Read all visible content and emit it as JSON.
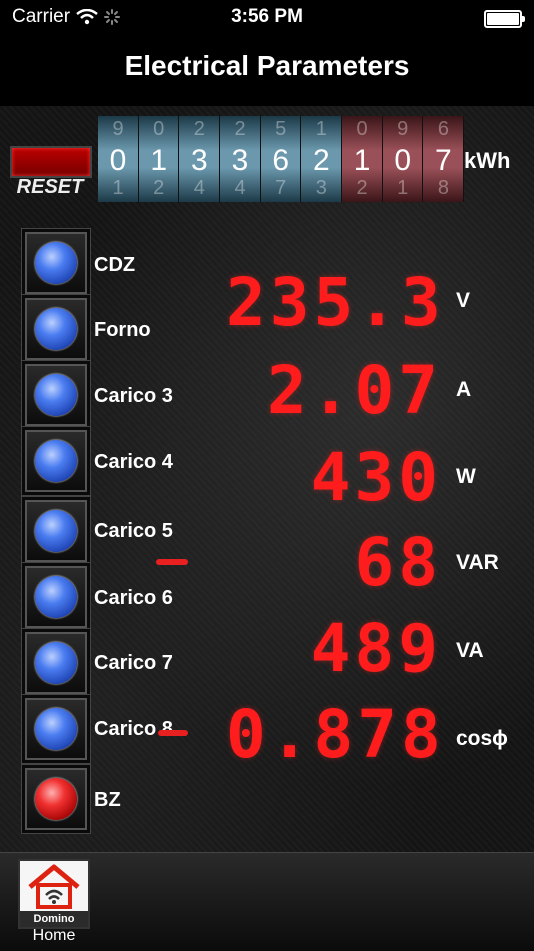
{
  "status_bar": {
    "carrier": "Carrier",
    "time": "3:56 PM"
  },
  "nav": {
    "title": "Electrical Parameters"
  },
  "reset": {
    "label": "RESET"
  },
  "energy": {
    "unit": "kWh",
    "digits": [
      {
        "prev": "9",
        "cur": "0",
        "next": "1",
        "style": "blue"
      },
      {
        "prev": "0",
        "cur": "1",
        "next": "2",
        "style": "blue"
      },
      {
        "prev": "2",
        "cur": "3",
        "next": "4",
        "style": "blue"
      },
      {
        "prev": "2",
        "cur": "3",
        "next": "4",
        "style": "blue"
      },
      {
        "prev": "5",
        "cur": "6",
        "next": "7",
        "style": "blue"
      },
      {
        "prev": "1",
        "cur": "2",
        "next": "3",
        "style": "blue"
      },
      {
        "prev": "0",
        "cur": "1",
        "next": "2",
        "style": "red"
      },
      {
        "prev": "9",
        "cur": "0",
        "next": "1",
        "style": "red"
      },
      {
        "prev": "6",
        "cur": "7",
        "next": "8",
        "style": "red"
      }
    ]
  },
  "loads": [
    {
      "label": "CDZ",
      "led": "blue"
    },
    {
      "label": "Forno",
      "led": "blue"
    },
    {
      "label": "Carico 3",
      "led": "blue"
    },
    {
      "label": "Carico 4",
      "led": "blue"
    },
    {
      "label": "Carico 5",
      "led": "blue"
    },
    {
      "label": "Carico 6",
      "led": "blue"
    },
    {
      "label": "Carico 7",
      "led": "blue"
    },
    {
      "label": "Carico 8",
      "led": "blue"
    },
    {
      "label": "BZ",
      "led": "red"
    }
  ],
  "readings": [
    {
      "value": "235.3",
      "unit": "V"
    },
    {
      "value": "2.07",
      "unit": "A"
    },
    {
      "value": "430",
      "unit": "W"
    },
    {
      "value": "68",
      "unit": "VAR"
    },
    {
      "value": "489",
      "unit": "VA"
    },
    {
      "value": "0.878",
      "unit": "cosϕ"
    }
  ],
  "tab_bar": {
    "home_label": "Home",
    "home_brand": "Domino"
  },
  "colors": {
    "display_red": "#ff1c1c",
    "led_blue": "#4a7cf0",
    "led_red": "#f03030",
    "reset_red": "#b00000"
  }
}
